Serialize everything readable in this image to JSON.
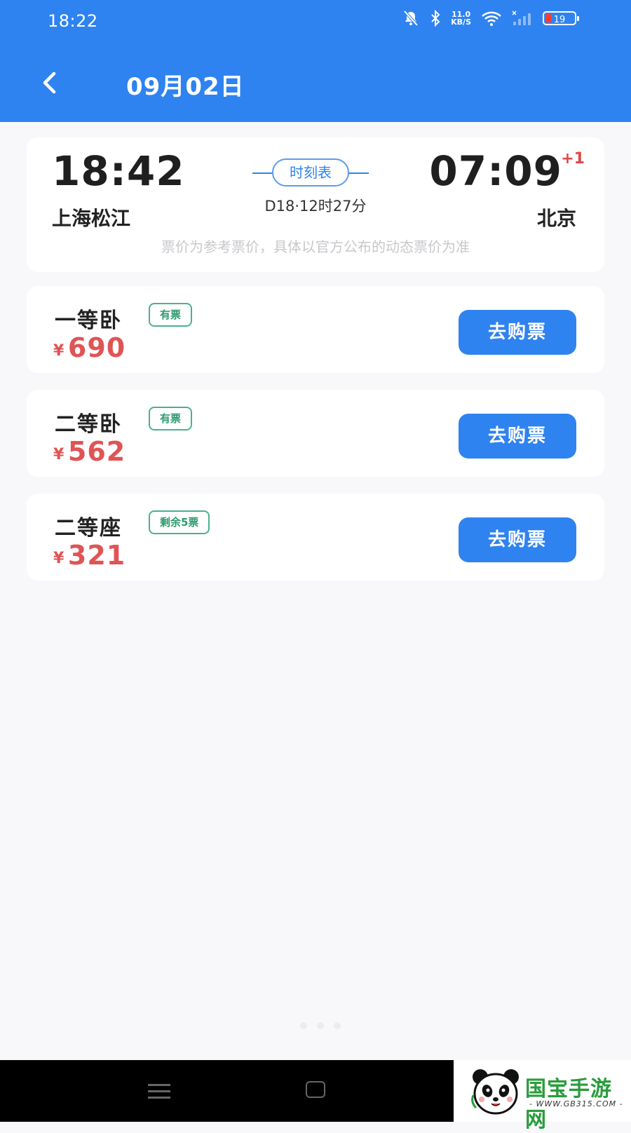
{
  "status_bar": {
    "time": "18:22",
    "net_speed_value": "11.0",
    "net_speed_unit": "KB/S",
    "battery": "19"
  },
  "header": {
    "title": "09月02日",
    "back_icon": "chevron-left-icon"
  },
  "trip": {
    "departure_time": "18:42",
    "arrival_time": "07:09",
    "arrival_day_offset": "+1",
    "departure_station": "上海松江",
    "arrival_station": "北京",
    "timetable_label": "时刻表",
    "train_info": "D18·12时27分",
    "price_note": "票价为参考票价，具体以官方公布的动态票价为准"
  },
  "tickets": [
    {
      "seat": "一等卧",
      "availability": "有票",
      "currency": "¥",
      "price": "690",
      "buy_label": "去购票"
    },
    {
      "seat": "二等卧",
      "availability": "有票",
      "currency": "¥",
      "price": "562",
      "buy_label": "去购票"
    },
    {
      "seat": "二等座",
      "availability": "剩余5票",
      "currency": "¥",
      "price": "321",
      "buy_label": "去购票"
    }
  ],
  "watermark": {
    "brand": "国宝手游网",
    "url": "- WWW.GB315.COM -"
  },
  "colors": {
    "primary": "#2f83f0",
    "price": "#e05454",
    "available": "#49b28a",
    "background": "#f8f8fb"
  }
}
